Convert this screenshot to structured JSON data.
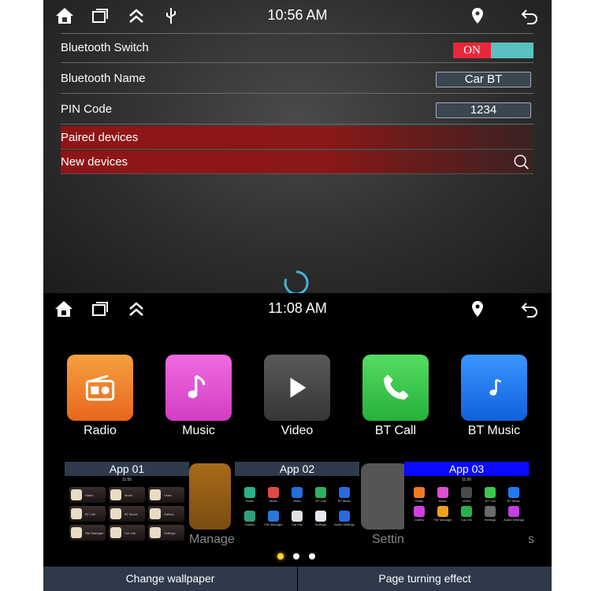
{
  "top_screen": {
    "status_bar": {
      "time": "10:56 AM",
      "icons": [
        "home-icon",
        "recent-apps-icon",
        "chevron-up-icon",
        "usb-icon",
        "location-icon",
        "back-icon"
      ]
    },
    "settings": [
      {
        "label": "Bluetooth Switch",
        "toggle": "ON",
        "toggle_state": true
      },
      {
        "label": "Bluetooth Name",
        "value": "Car BT"
      },
      {
        "label": "PIN Code",
        "value": "1234"
      }
    ],
    "sections": [
      {
        "label": "Paired devices"
      },
      {
        "label": "New devices",
        "icon": "search-icon"
      }
    ]
  },
  "bottom_screen": {
    "status_bar": {
      "time": "11:08 AM"
    },
    "apps": [
      {
        "label": "Radio",
        "color": "#f08a2a"
      },
      {
        "label": "Music",
        "color": "#e04fd2"
      },
      {
        "label": "Video",
        "color": "#4a4a4a"
      },
      {
        "label": "BT Call",
        "color": "#3cc84c"
      },
      {
        "label": "BT Music",
        "color": "#1e7cf0"
      }
    ],
    "background_labels": [
      "Manager",
      "Settin",
      "s"
    ],
    "thumbnails": [
      {
        "title": "App 01",
        "time": "11:55",
        "items": [
          "Radio",
          "Music",
          "Video",
          "BT Call",
          "BT Music",
          "Gallery",
          "File Manager",
          "Car Info",
          "Settings"
        ]
      },
      {
        "title": "App 02",
        "time": "",
        "items": [
          "Radio",
          "Music",
          "Video",
          "BT Call",
          "BT Music",
          "Gallery",
          "File Manager",
          "Car Info",
          "Settings",
          "Audio Settings"
        ]
      },
      {
        "title": "App 03",
        "time": "11:56",
        "selected": true,
        "items": [
          "Radio",
          "Music",
          "Video",
          "BT Call",
          "BT Music",
          "Gallery",
          "File Manager",
          "Car Info",
          "Settings",
          "Audio Settings"
        ]
      }
    ],
    "page_indicator": {
      "pages": 3,
      "current": 1
    },
    "buttons": {
      "change_wallpaper": "Change wallpaper",
      "page_turning": "Page turning effect"
    }
  }
}
